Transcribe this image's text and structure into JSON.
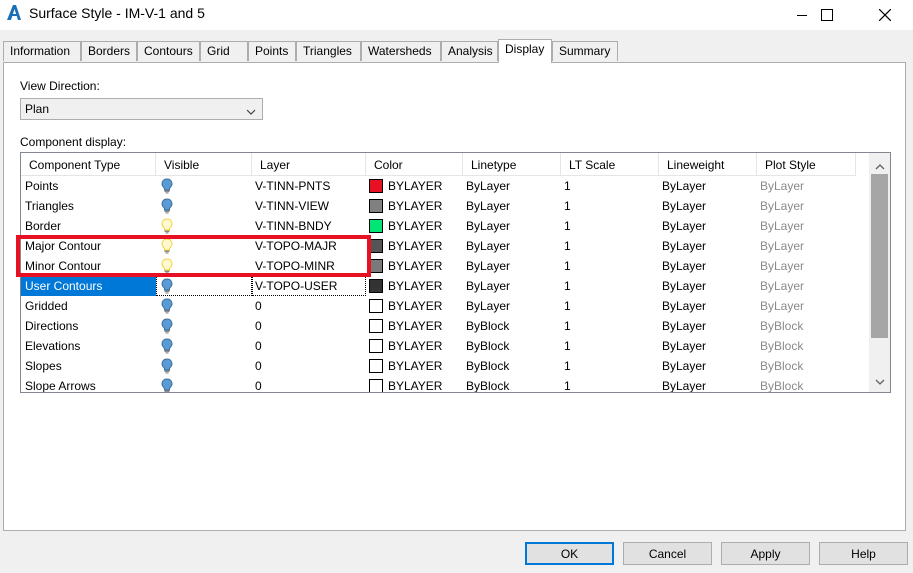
{
  "window": {
    "title": "Surface Style - IM-V-1 and 5",
    "app_icon": "autocad-a-icon",
    "minimize_icon": "minimize-icon",
    "maximize_icon": "maximize-icon",
    "close_icon": "close-icon"
  },
  "tabs": [
    {
      "label": "Information",
      "active": false
    },
    {
      "label": "Borders",
      "active": false
    },
    {
      "label": "Contours",
      "active": false
    },
    {
      "label": "Grid",
      "active": false
    },
    {
      "label": "Points",
      "active": false
    },
    {
      "label": "Triangles",
      "active": false
    },
    {
      "label": "Watersheds",
      "active": false
    },
    {
      "label": "Analysis",
      "active": false
    },
    {
      "label": "Display",
      "active": true
    },
    {
      "label": "Summary",
      "active": false
    }
  ],
  "view_direction": {
    "label": "View Direction:",
    "value": "Plan"
  },
  "component_display": {
    "label": "Component display:",
    "columns": [
      "Component Type",
      "Visible",
      "Layer",
      "Color",
      "Linetype",
      "LT Scale",
      "Lineweight",
      "Plot Style"
    ],
    "rows": [
      {
        "type": "Points",
        "visible": true,
        "layer": "V-TINN-PNTS",
        "color_hex": "#e81123",
        "color": "BYLAYER",
        "linetype": "ByLayer",
        "lt_scale": "1",
        "lineweight": "ByLayer",
        "plot_style": "ByLayer",
        "selected": false
      },
      {
        "type": "Triangles",
        "visible": true,
        "layer": "V-TINN-VIEW",
        "color_hex": "#808080",
        "color": "BYLAYER",
        "linetype": "ByLayer",
        "lt_scale": "1",
        "lineweight": "ByLayer",
        "plot_style": "ByLayer",
        "selected": false
      },
      {
        "type": "Border",
        "visible": false,
        "layer": "V-TINN-BNDY",
        "color_hex": "#00e676",
        "color": "BYLAYER",
        "linetype": "ByLayer",
        "lt_scale": "1",
        "lineweight": "ByLayer",
        "plot_style": "ByLayer",
        "selected": false
      },
      {
        "type": "Major Contour",
        "visible": false,
        "layer": "V-TOPO-MAJR",
        "color_hex": "#555555",
        "color": "BYLAYER",
        "linetype": "ByLayer",
        "lt_scale": "1",
        "lineweight": "ByLayer",
        "plot_style": "ByLayer",
        "selected": false
      },
      {
        "type": "Minor Contour",
        "visible": false,
        "layer": "V-TOPO-MINR",
        "color_hex": "#7a7a7a",
        "color": "BYLAYER",
        "linetype": "ByLayer",
        "lt_scale": "1",
        "lineweight": "ByLayer",
        "plot_style": "ByLayer",
        "selected": false
      },
      {
        "type": "User Contours",
        "visible": true,
        "layer": "V-TOPO-USER",
        "color_hex": "#333333",
        "color": "BYLAYER",
        "linetype": "ByLayer",
        "lt_scale": "1",
        "lineweight": "ByLayer",
        "plot_style": "ByLayer",
        "selected": true
      },
      {
        "type": "Gridded",
        "visible": true,
        "layer": "0",
        "color_hex": "#ffffff",
        "color": "BYLAYER",
        "linetype": "ByLayer",
        "lt_scale": "1",
        "lineweight": "ByLayer",
        "plot_style": "ByLayer",
        "selected": false
      },
      {
        "type": "Directions",
        "visible": true,
        "layer": "0",
        "color_hex": "#ffffff",
        "color": "BYLAYER",
        "linetype": "ByBlock",
        "lt_scale": "1",
        "lineweight": "ByLayer",
        "plot_style": "ByBlock",
        "selected": false
      },
      {
        "type": "Elevations",
        "visible": true,
        "layer": "0",
        "color_hex": "#ffffff",
        "color": "BYLAYER",
        "linetype": "ByBlock",
        "lt_scale": "1",
        "lineweight": "ByLayer",
        "plot_style": "ByBlock",
        "selected": false
      },
      {
        "type": "Slopes",
        "visible": true,
        "layer": "0",
        "color_hex": "#ffffff",
        "color": "BYLAYER",
        "linetype": "ByBlock",
        "lt_scale": "1",
        "lineweight": "ByLayer",
        "plot_style": "ByBlock",
        "selected": false
      },
      {
        "type": "Slope Arrows",
        "visible": true,
        "layer": "0",
        "color_hex": "#ffffff",
        "color": "BYLAYER",
        "linetype": "ByBlock",
        "lt_scale": "1",
        "lineweight": "ByLayer",
        "plot_style": "ByBlock",
        "selected": false
      }
    ]
  },
  "buttons": {
    "ok": "OK",
    "cancel": "Cancel",
    "apply": "Apply",
    "help": "Help"
  },
  "colors": {
    "accent": "#0078d7",
    "highlight_box": "#e81123",
    "bulb_on": "#5b9bd5",
    "bulb_off": "#f2d43a"
  }
}
